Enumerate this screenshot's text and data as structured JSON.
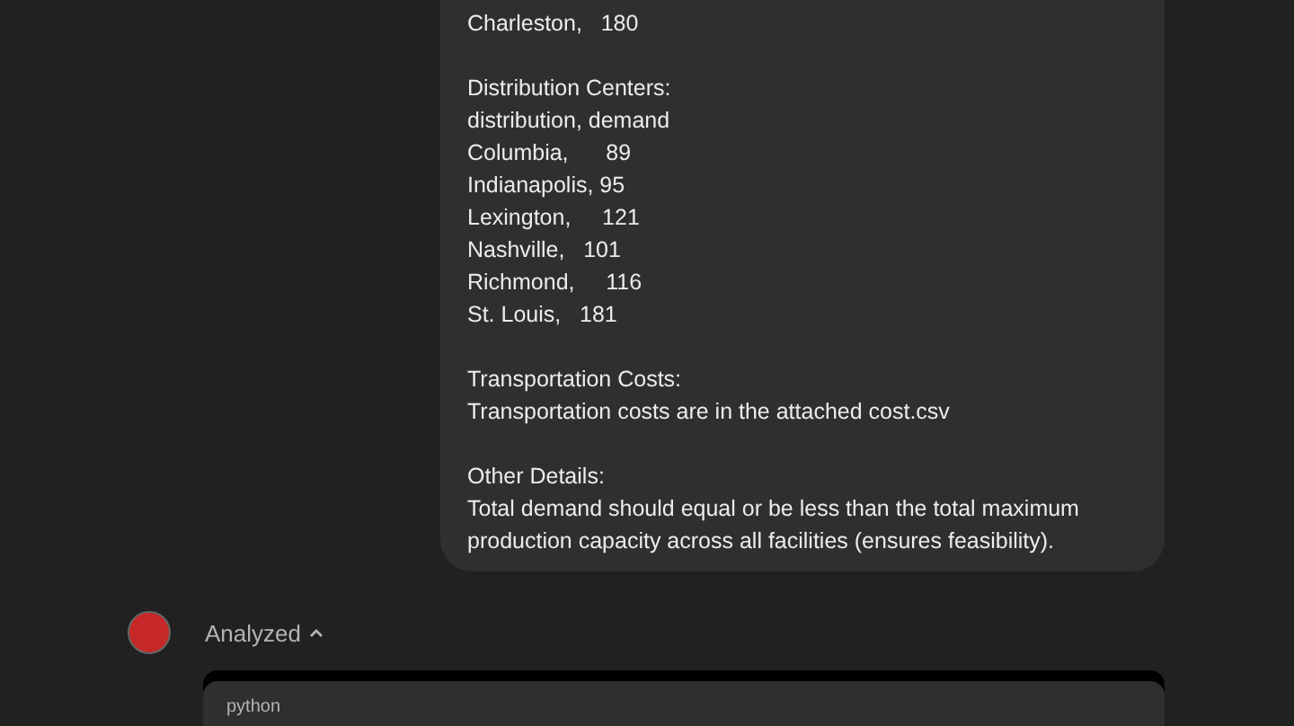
{
  "message": {
    "paragraphs": [
      [
        "Charleston,   180"
      ],
      [
        "Distribution Centers:",
        "distribution, demand",
        "Columbia,      89",
        "Indianapolis, 95",
        "Lexington,     121",
        "Nashville,   101",
        "Richmond,     116",
        "St. Louis,   181"
      ],
      [
        "Transportation Costs:",
        "Transportation costs are in the attached cost.csv"
      ],
      [
        "Other Details:",
        "Total demand should equal or be less than the total maximum production capacity across all facilities (ensures feasibility)."
      ]
    ]
  },
  "assistant": {
    "status": "Analyzed",
    "expanded": true,
    "code_block": {
      "language": "python"
    }
  }
}
